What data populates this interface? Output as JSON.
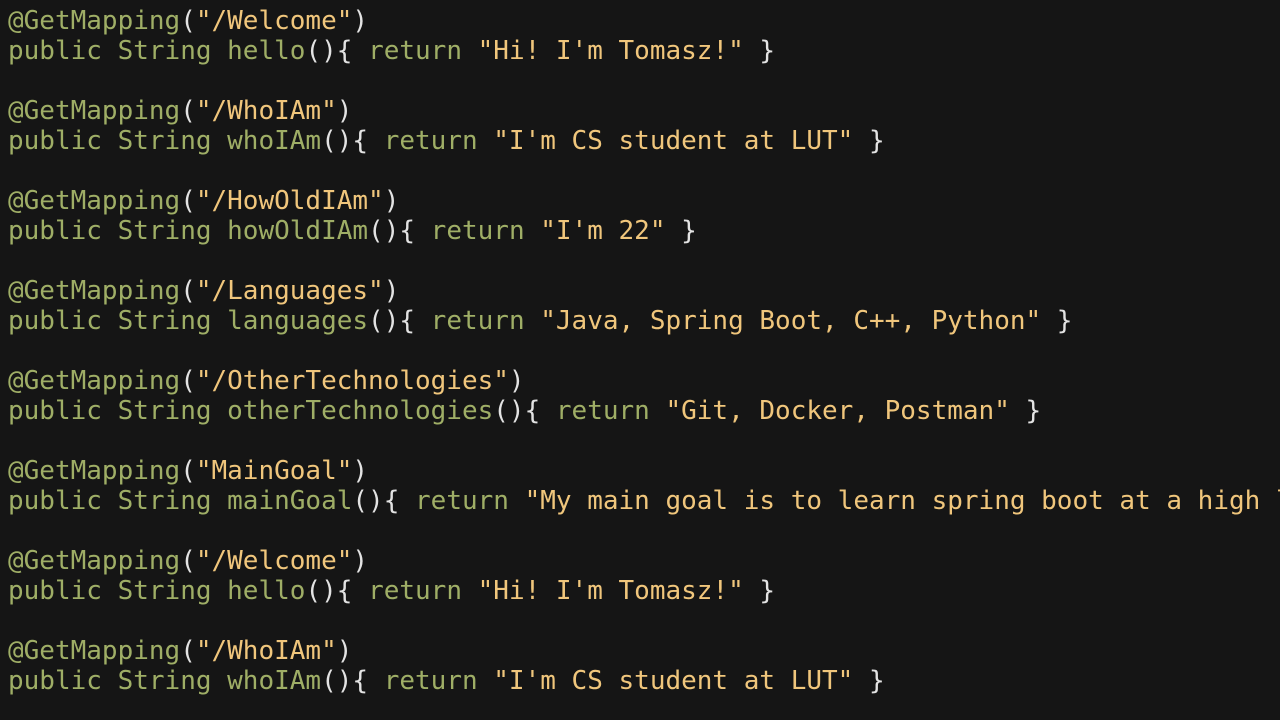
{
  "colors": {
    "background": "#151515",
    "keyword": "#9fae66",
    "string": "#f0c67c",
    "punctuation": "#e3e3e3"
  },
  "blocks": [
    {
      "annotation": "@GetMapping",
      "path": "\"/Welcome\"",
      "modifier": "public",
      "type": "String",
      "method": "hello",
      "ret": "return",
      "value": "\"Hi! I'm Tomasz!\""
    },
    {
      "annotation": "@GetMapping",
      "path": "\"/WhoIAm\"",
      "modifier": "public",
      "type": "String",
      "method": "whoIAm",
      "ret": "return",
      "value": "\"I'm CS student at LUT\""
    },
    {
      "annotation": "@GetMapping",
      "path": "\"/HowOldIAm\"",
      "modifier": "public",
      "type": "String",
      "method": "howOldIAm",
      "ret": "return",
      "value": "\"I'm 22\""
    },
    {
      "annotation": "@GetMapping",
      "path": "\"/Languages\"",
      "modifier": "public",
      "type": "String",
      "method": "languages",
      "ret": "return",
      "value": "\"Java, Spring Boot, C++, Python\""
    },
    {
      "annotation": "@GetMapping",
      "path": "\"/OtherTechnologies\"",
      "modifier": "public",
      "type": "String",
      "method": "otherTechnologies",
      "ret": "return",
      "value": "\"Git, Docker, Postman\""
    },
    {
      "annotation": "@GetMapping",
      "path": "\"MainGoal\"",
      "modifier": "public",
      "type": "String",
      "method": "mainGoal",
      "ret": "return",
      "value": "\"My main goal is to learn spring boot at a high l"
    },
    {
      "annotation": "@GetMapping",
      "path": "\"/Welcome\"",
      "modifier": "public",
      "type": "String",
      "method": "hello",
      "ret": "return",
      "value": "\"Hi! I'm Tomasz!\""
    },
    {
      "annotation": "@GetMapping",
      "path": "\"/WhoIAm\"",
      "modifier": "public",
      "type": "String",
      "method": "whoIAm",
      "ret": "return",
      "value": "\"I'm CS student at LUT\""
    }
  ]
}
